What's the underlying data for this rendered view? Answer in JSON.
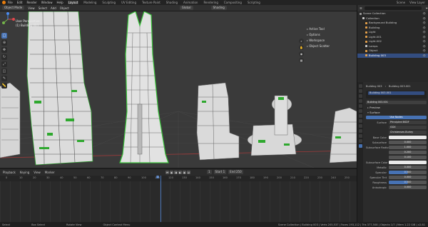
{
  "topbar": {
    "menus": [
      "File",
      "Edit",
      "Render",
      "Window",
      "Help"
    ],
    "workspaces": [
      "Layout",
      "Modeling",
      "Sculpting",
      "UV Editing",
      "Texture Paint",
      "Shading",
      "Animation",
      "Rendering",
      "Compositing",
      "Scripting"
    ],
    "active_workspace": "Layout",
    "scene": "Scene",
    "view_layer": "View Layer"
  },
  "viewport_header": {
    "mode": "Object Mode",
    "items": [
      "View",
      "Select",
      "Add",
      "Object"
    ],
    "orientation": "Global",
    "shading": "Shading"
  },
  "viewport": {
    "overlay_line1": "User Perspective",
    "overlay_line2": "(1) Building 003",
    "popup": [
      "Active Tool",
      "Options",
      "Workspace",
      "Object Scatter"
    ]
  },
  "timeline": {
    "menus": [
      "Playback",
      "Keying",
      "View",
      "Marker"
    ],
    "current_frame": "1",
    "start": "Start 1",
    "end": "End 250",
    "ticks": [
      "0",
      "10",
      "20",
      "30",
      "40",
      "50",
      "60",
      "70",
      "80",
      "90",
      "100",
      "110",
      "120",
      "130",
      "140",
      "150",
      "160",
      "170",
      "180",
      "190",
      "200",
      "210",
      "220",
      "230",
      "240",
      "250"
    ]
  },
  "statusbar": {
    "select": "Select",
    "box_select": "Box Select",
    "rotate_view": "Rotate View",
    "context_menu": "Object Context Menu",
    "stats": "Scene Collection | Building 003 | Verts 205,537 | Faces 193,112 | Tris 377,508 | Objects 1/7 | Mem 1.22 GiB | v2.81"
  },
  "outliner": {
    "title": "Scene Collection",
    "search_placeholder": "",
    "rows": [
      {
        "label": "Scene Collection",
        "color": "#9a9a9a",
        "selected": false
      },
      {
        "label": "Collection",
        "color": "#d0d0d0",
        "selected": false
      },
      {
        "label": "Background Building",
        "color": "#e8a24a",
        "selected": false
      },
      {
        "label": "Building",
        "color": "#e8a24a",
        "selected": false
      },
      {
        "label": "Light",
        "color": "#e8a24a",
        "selected": false
      },
      {
        "label": "Light.001",
        "color": "#e8a24a",
        "selected": false
      },
      {
        "label": "Light.002",
        "color": "#e8a24a",
        "selected": false
      },
      {
        "label": "Lamps",
        "color": "#d0d0d0",
        "selected": false
      },
      {
        "label": "Object",
        "color": "#e8a24a",
        "selected": false
      },
      {
        "label": "Building 003",
        "color": "#e8a24a",
        "selected": true
      }
    ]
  },
  "properties": {
    "object": "Building 003",
    "material_name": "Building 003.001",
    "slot": "Building 003.001",
    "surface_button": "Use Nodes",
    "preview": "Preview",
    "surface": "Surface",
    "surface_shader": "Principled BSDF",
    "dist": "GGX",
    "subsurface_method": "Christensen-Burley",
    "rows": [
      {
        "label": "Base Color",
        "value": "",
        "kind": "color"
      },
      {
        "label": "Subsurface",
        "value": "0.000",
        "kind": "num"
      },
      {
        "label": "Subsurface Radius",
        "value": "1.000",
        "kind": "num"
      },
      {
        "label": "",
        "value": "0.200",
        "kind": "num"
      },
      {
        "label": "",
        "value": "0.100",
        "kind": "num"
      },
      {
        "label": "Subsurface Color",
        "value": "",
        "kind": "color"
      },
      {
        "label": "Metallic",
        "value": "0.000",
        "kind": "num"
      },
      {
        "label": "Specular",
        "value": "0.500",
        "kind": "val"
      },
      {
        "label": "Specular Tint",
        "value": "0.000",
        "kind": "num"
      },
      {
        "label": "Roughness",
        "value": "0.500",
        "kind": "val"
      },
      {
        "label": "Anisotropic",
        "value": "0.000",
        "kind": "num"
      }
    ]
  }
}
